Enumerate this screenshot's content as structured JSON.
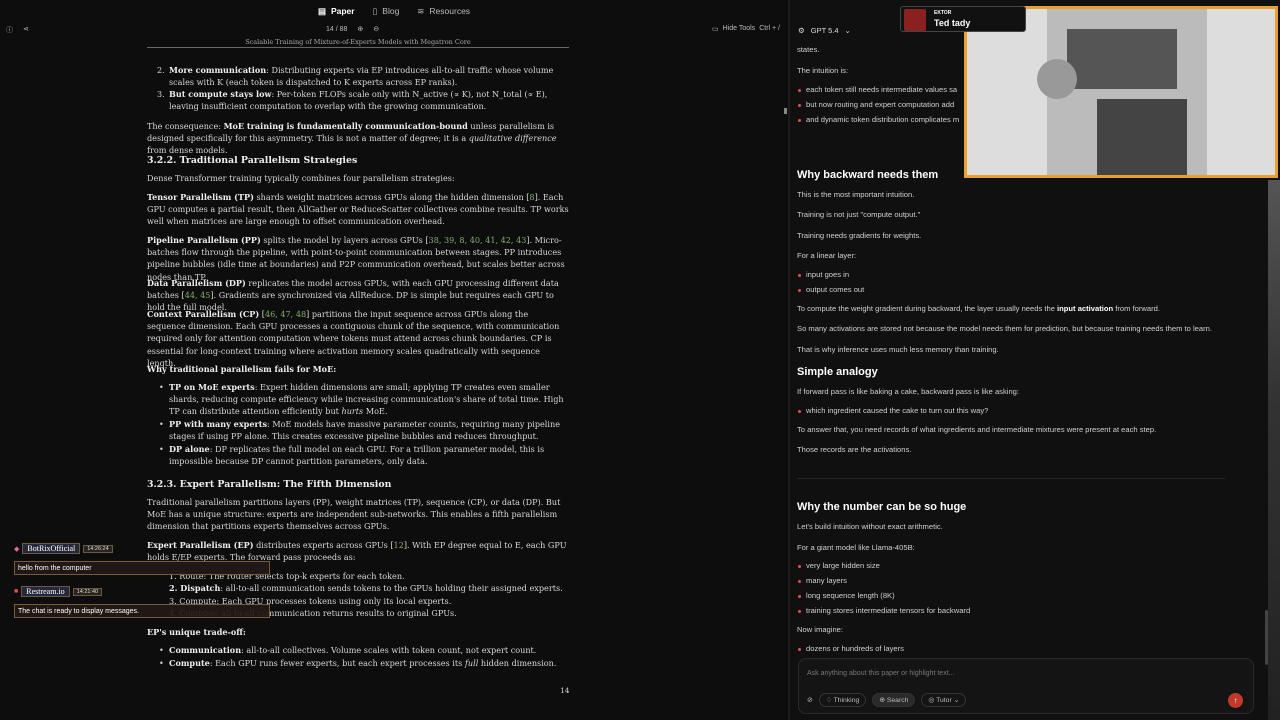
{
  "nav": {
    "tabs": [
      "Paper",
      "Blog",
      "Resources"
    ],
    "active": "Paper"
  },
  "toolbar": {
    "page": "14 / 88",
    "hide_tools": "Hide Tools",
    "shortcut": "Ctrl + /"
  },
  "paper": {
    "running_head": "Scalable Training of Mixture-of-Experts Models with Megatron Core",
    "p1": {
      "num": "2.",
      "lead": "More communication",
      "text": ": Distributing experts via EP introduces all-to-all traffic whose volume scales with K (each token is dispatched to K experts across EP ranks)."
    },
    "p2": {
      "num": "3.",
      "lead": "But compute stays low",
      "text": ": Per-token FLOPs scale only with N_active (∝ K), not N_total (∝ E), leaving insufficient computation to overlap with the growing communication."
    },
    "p3": {
      "a": "The consequence: ",
      "b": "MoE training is fundamentally communication-bound",
      "c": " unless parallelism is designed specifically for this asymmetry. This is not a matter of degree; it is a ",
      "d": "qualitative difference",
      "e": " from dense models."
    },
    "h322": "3.2.2.  Traditional Parallelism Strategies",
    "p4": "Dense Transformer training typically combines four parallelism strategies:",
    "tp": {
      "lead": "Tensor Parallelism (TP)",
      "a": " shards weight matrices across GPUs along the hidden dimension [",
      "c": "8",
      "b": "]. Each GPU computes a partial result, then AllGather or ReduceScatter collectives combine results. TP works well when matrices are large enough to offset communication overhead."
    },
    "pp": {
      "lead": "Pipeline Parallelism (PP)",
      "a": " splits the model by layers across GPUs [",
      "c": "38, 39, 8, 40, 41, 42, 43",
      "b": "]. Micro-batches flow through the pipeline, with point-to-point communication between stages. PP introduces pipeline bubbles (idle time at boundaries) and P2P communication overhead, but scales better across nodes than TP."
    },
    "dp": {
      "lead": "Data Parallelism (DP)",
      "a": " replicates the model across GPUs, with each GPU processing different data batches [",
      "c": "44, 45",
      "b": "]. Gradients are synchronized via AllReduce. DP is simple but requires each GPU to hold the full model."
    },
    "cp": {
      "lead": "Context Parallelism (CP)",
      "a": " [",
      "c": "46, 47, 48",
      "b": "] partitions the input sequence across GPUs along the sequence dimension. Each GPU processes a contiguous chunk of the sequence, with communication required only for attention computation where tokens must attend across chunk boundaries. CP is essential for long-context training where activation memory scales quadratically with sequence length."
    },
    "why": "Why traditional parallelism fails for MoE:",
    "b1": {
      "lead": "TP on MoE experts",
      "a": ": Expert hidden dimensions are small; applying TP creates even smaller shards, reducing compute efficiency while increasing communication's share of total time. High TP can distribute attention efficiently but ",
      "i": "hurts",
      "b": " MoE."
    },
    "b2": {
      "lead": "PP with many experts",
      "a": ": MoE models have massive parameter counts, requiring many pipeline stages if using PP alone. This creates excessive pipeline bubbles and reduces throughput."
    },
    "b3": {
      "lead": "DP alone",
      "a": ": DP replicates the full model on each GPU. For a trillion parameter model, this is impossible because DP cannot partition parameters, only data."
    },
    "h323": "3.2.3.  Expert Parallelism: The Fifth Dimension",
    "p5": "Traditional parallelism partitions layers (PP), weight matrices (TP), sequence (CP), or data (DP). But MoE has a unique structure: experts are independent sub-networks. This enables a fifth parallelism dimension that partitions experts themselves across GPUs.",
    "p6a": "Expert Parallelism (EP)",
    "p6b": " distributes experts across GPUs [",
    "p6c": "12",
    "p6d": "]. With EP degree equal to E, each GPU holds E/EP experts. The forward pass proceeds as:",
    "s1": "1.  Route: The router selects top-k experts for each token.",
    "s2a": "2.  Dispatch",
    "s2b": ": all-to-all communication sends tokens to the GPUs holding their assigned experts.",
    "s3": "3.  Compute: Each GPU processes tokens using only its local experts.",
    "s4": "4.  Combine: all-to-all communication returns results to original GPUs.",
    "trade": "EP's unique trade-off:",
    "t1a": "Communication",
    "t1b": ": all-to-all collectives. Volume scales with token count, not expert count.",
    "t2a": "Compute",
    "t2b": ": Each GPU runs fewer experts, but each expert processes its ",
    "t2c": "full",
    "t2d": " hidden dimension.",
    "page_number": "14"
  },
  "chat": [
    {
      "user": "BotRixOfficial",
      "time": "14:26:24",
      "message": "hello from the computer"
    },
    {
      "user": "Restream.io",
      "time": "14:21:40",
      "message": "The chat is ready to display messages."
    }
  ],
  "assistant": {
    "model": "GPT 5.4",
    "lines": {
      "states": "states.",
      "intuition": "The intuition is:",
      "i1": "each token still needs intermediate values sa",
      "i2": "but now routing and expert computation add",
      "i3": "and dynamic token distribution complicates m",
      "h1": "Why backward needs them",
      "l1": "This is the most important intuition.",
      "l2": "Training is not just \"compute output.\"",
      "l3": "Training needs gradients for weights.",
      "l4": "For a linear layer:",
      "l5": "input goes in",
      "l6": "output comes out",
      "l7a": "To compute the weight gradient during backward, the layer usually needs the ",
      "l7b": "input activation",
      "l7c": " from forward.",
      "l8": "So many activations are stored not because the model needs them for prediction, but because training needs them to learn.",
      "l9": "That is why inference uses much less memory than training.",
      "h2": "Simple analogy",
      "l10": "If forward pass is like baking a cake, backward pass is like asking:",
      "l11": "which ingredient caused the cake to turn out this way?",
      "l12": "To answer that, you need records of what ingredients and intermediate mixtures were present at each step.",
      "l13": "Those records are the activations.",
      "h3": "Why the number can be so huge",
      "l14": "Let's build intuition without exact arithmetic.",
      "l15": "For a giant model like Llama-405B:",
      "l16": "very large hidden size",
      "l17": "many layers",
      "l18": "long sequence length (8K)",
      "l19": "training stores intermediate tensors for backward",
      "l20": "Now imagine:",
      "l21": "dozens or hundreds of layers"
    },
    "input_placeholder": "Ask anything about this paper or highlight text...",
    "tools": {
      "thinking": "Thinking",
      "search": "Search",
      "tutor": "Tutor"
    }
  },
  "streamer": {
    "label": "EKTOR",
    "name": "Ted tady"
  },
  "colors": {
    "accent_red": "#e05050",
    "cite_green": "#7fb06a",
    "webcam_border": "#e8a030"
  }
}
